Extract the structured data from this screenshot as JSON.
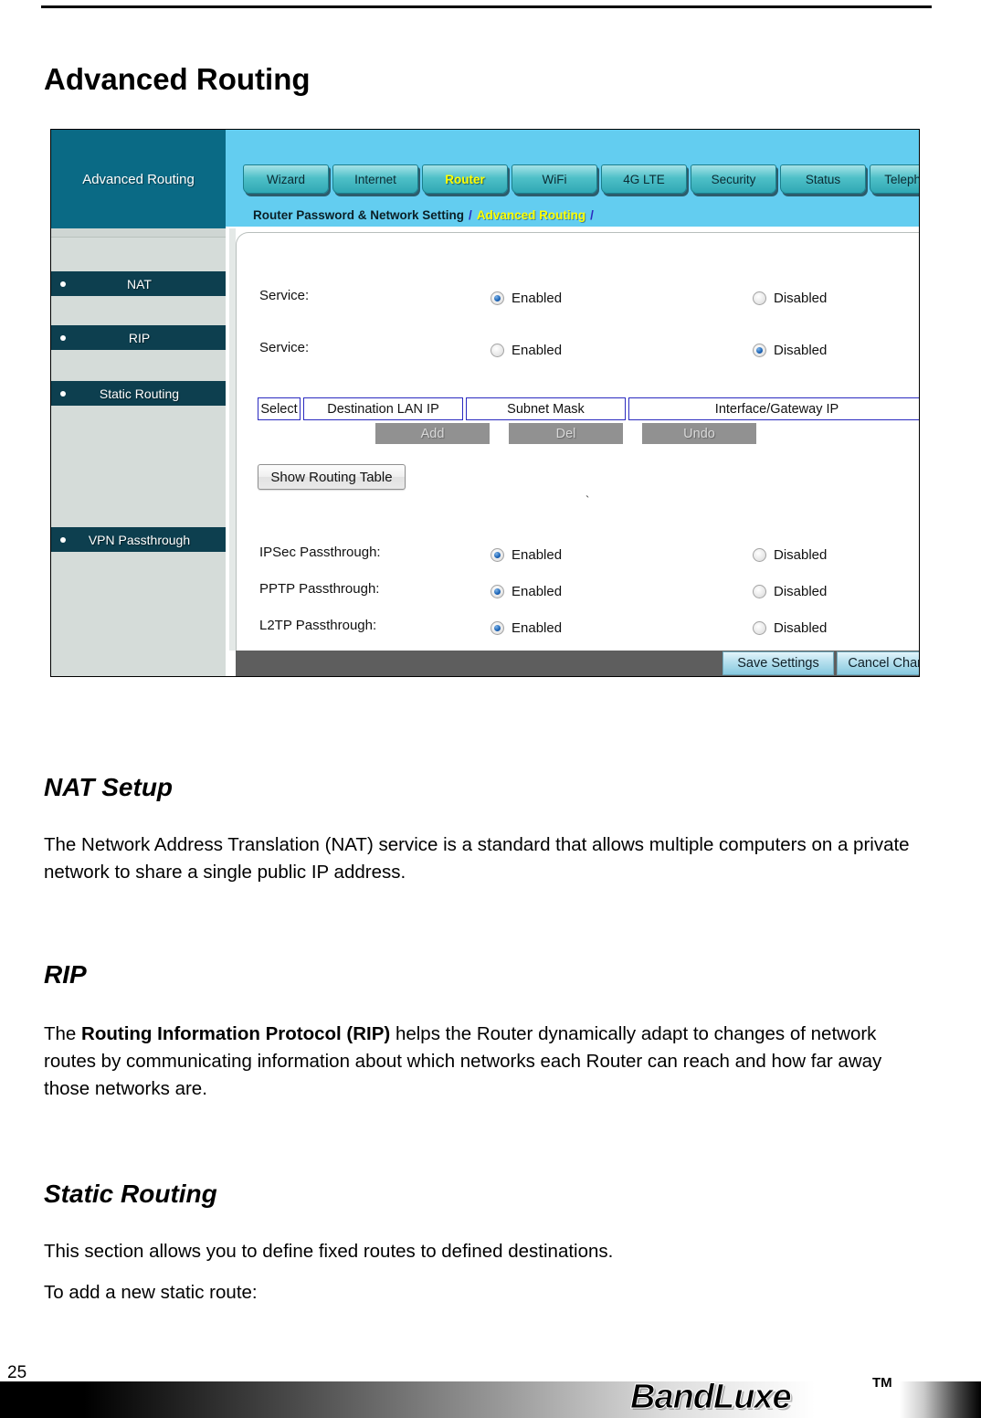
{
  "document": {
    "page_title": "Advanced Routing",
    "page_number": "25",
    "brand": "BandLuxe",
    "brand_tm": "TM"
  },
  "figure": {
    "sidebar": {
      "header": "Advanced Routing",
      "items": [
        {
          "label": "NAT"
        },
        {
          "label": "RIP"
        },
        {
          "label": "Static Routing"
        },
        {
          "label": "VPN Passthrough"
        }
      ]
    },
    "tabs": [
      {
        "label": "Wizard",
        "active": false
      },
      {
        "label": "Internet",
        "active": false
      },
      {
        "label": "Router",
        "active": true
      },
      {
        "label": "WiFi",
        "active": false
      },
      {
        "label": "4G LTE",
        "active": false
      },
      {
        "label": "Security",
        "active": false
      },
      {
        "label": "Status",
        "active": false
      },
      {
        "label": "Telephony",
        "active": false
      }
    ],
    "breadcrumb": {
      "first": "Router Password & Network Setting",
      "sep1": "/",
      "second": "Advanced Routing",
      "sep2": "/"
    },
    "form": {
      "rows": [
        {
          "label": "Service:",
          "enabled_label": "Enabled",
          "disabled_label": "Disabled",
          "selected": "enabled"
        },
        {
          "label": "Service:",
          "enabled_label": "Enabled",
          "disabled_label": "Disabled",
          "selected": "disabled"
        }
      ],
      "route_table": {
        "columns": [
          "Select",
          "Destination LAN IP",
          "Subnet Mask",
          "Interface/Gateway IP"
        ]
      },
      "route_buttons": [
        "Add",
        "Del",
        "Undo"
      ],
      "show_routing_table_label": "Show Routing Table",
      "passthrough_rows": [
        {
          "label": "IPSec Passthrough:",
          "enabled_label": "Enabled",
          "disabled_label": "Disabled",
          "selected": "enabled"
        },
        {
          "label": "PPTP Passthrough:",
          "enabled_label": "Enabled",
          "disabled_label": "Disabled",
          "selected": "enabled"
        },
        {
          "label": "L2TP Passthrough:",
          "enabled_label": "Enabled",
          "disabled_label": "Disabled",
          "selected": "enabled"
        }
      ],
      "save_label": "Save Settings",
      "cancel_label": "Cancel Changes"
    }
  },
  "sections": {
    "nat": {
      "heading": "NAT Setup",
      "body": "The Network Address Translation (NAT) service is a standard that allows multiple computers on a private network to share a single public IP address."
    },
    "rip": {
      "heading": "RIP",
      "body_before": "The ",
      "body_bold": "Routing Information Protocol (RIP)",
      "body_after": " helps the Router dynamically adapt to changes of network routes by communicating information about which networks each Router can reach and how far away those networks are."
    },
    "static": {
      "heading": "Static Routing",
      "body1": "This section allows you to define fixed routes to defined destinations.",
      "body2": "To add a new static route:"
    }
  }
}
